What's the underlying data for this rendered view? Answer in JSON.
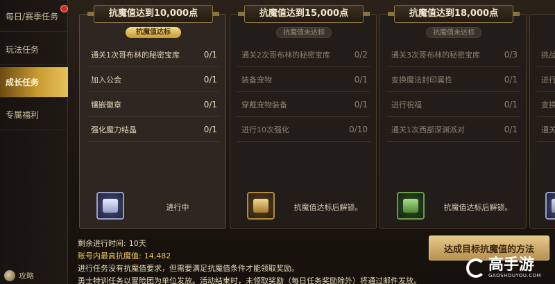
{
  "sidebar": {
    "items": [
      {
        "label": "每日/赛季任务",
        "active": false
      },
      {
        "label": "玩法任务",
        "active": false
      },
      {
        "label": "成长任务",
        "active": true
      },
      {
        "label": "专属福利",
        "active": false
      }
    ],
    "strategy_label": "攻略"
  },
  "cards": [
    {
      "title": "抗魔值达到10,000点",
      "badge": "抗魔值达标",
      "badge_state": "reached",
      "tasks": [
        {
          "name": "通关1次哥布林的秘密宝库",
          "count": "0/1"
        },
        {
          "name": "加入公会",
          "count": "0/1"
        },
        {
          "name": "镶嵌徽章",
          "count": "0/1"
        },
        {
          "name": "强化魔力结晶",
          "count": "0/1"
        }
      ],
      "reward_icon": "silver-chest-icon",
      "status": "进行中"
    },
    {
      "title": "抗魔值达到15,000点",
      "badge": "抗魔值未达标",
      "badge_state": "not-reached",
      "tasks": [
        {
          "name": "通关2次哥布林的秘密宝库",
          "count": "0/2"
        },
        {
          "name": "装备宠物",
          "count": "0/1"
        },
        {
          "name": "穿戴宠物装备",
          "count": "0/1"
        },
        {
          "name": "进行10次强化",
          "count": "0/10"
        }
      ],
      "reward_icon": "gold-chest-icon",
      "status": "抗魔值达标后解锁。"
    },
    {
      "title": "抗魔值达到18,000点",
      "badge": "抗魔值未达标",
      "badge_state": "not-reached",
      "tasks": [
        {
          "name": "通关3次哥布林的秘密宝库",
          "count": "0/3"
        },
        {
          "name": "变换魔法封印属性",
          "count": "0/1"
        },
        {
          "name": "进行祝福",
          "count": "0/1"
        },
        {
          "name": "通关1次西部深渊派对",
          "count": "0/1"
        }
      ],
      "reward_icon": "green-chest-icon",
      "status": "抗魔值达标后解锁。"
    },
    {
      "title": "",
      "badge": "",
      "badge_state": "not-reached",
      "tasks": [
        {
          "name": "挑战",
          "count": ""
        },
        {
          "name": "进行",
          "count": ""
        },
        {
          "name": "变换",
          "count": ""
        },
        {
          "name": "通关",
          "count": ""
        }
      ],
      "reward_icon": "chest-icon",
      "status": ""
    }
  ],
  "info": {
    "remaining_label": "剩余进行时间:",
    "remaining_value": "10天",
    "max_label": "账号内最高抗魔值:",
    "max_value": "14,482",
    "note1": "进行任务没有抗魔值要求，但需要满足抗魔值条件才能领取奖励。",
    "note2": "勇士特训任务以冒险团为单位发放。活动结束时，未领取奖励（每日任务奖励除外）将通过邮件发放。"
  },
  "method_button": "达成目标抗魔值的方法",
  "watermark": {
    "main": "高手游",
    "sub": "GAOSHOUYOU.COM"
  },
  "colors": {
    "accent": "#c89a30",
    "highlight": "#f0c35c"
  }
}
